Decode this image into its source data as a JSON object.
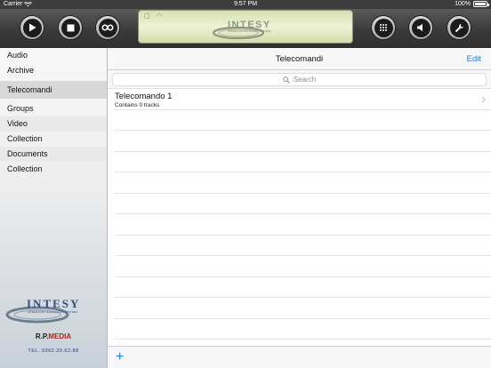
{
  "statusbar": {
    "carrier": "Carrier",
    "time": "9:57 PM",
    "battery": "100%"
  },
  "toolbar": {
    "buttons": [
      "play-icon",
      "stop-icon",
      "repeat-icon",
      "keypad-icon",
      "volume-icon",
      "wrench-icon"
    ],
    "display_logo": "INTESY",
    "display_logo_sub": "INTEGRATOR TECHNOLOGY SYSTEMS"
  },
  "sidebar": {
    "items": [
      {
        "label": "Audio"
      },
      {
        "label": "Archive"
      },
      {
        "label": "Telecomandi"
      },
      {
        "label": "Groups"
      },
      {
        "label": "Video"
      },
      {
        "label": "Collection"
      },
      {
        "label": "Documents"
      },
      {
        "label": "Collection"
      }
    ],
    "logo_text": "INTESY",
    "logo_sub": "INTEGRATOR TECHNOLOGY SYSTEMS",
    "rpmedia_rp": "R.P.",
    "rpmedia_media": "MEDIA",
    "tel": "TEL. 0362.30.62.88"
  },
  "main": {
    "title": "Telecomandi",
    "edit_label": "Edit",
    "search_placeholder": "Search",
    "rows": [
      {
        "title": "Telecomando 1",
        "subtitle": "Contains 0 tracks"
      }
    ],
    "add_label": "+"
  },
  "colors": {
    "accent": "#147efb",
    "toolbar": "#3a3a3a",
    "display": "#e4eac4"
  }
}
